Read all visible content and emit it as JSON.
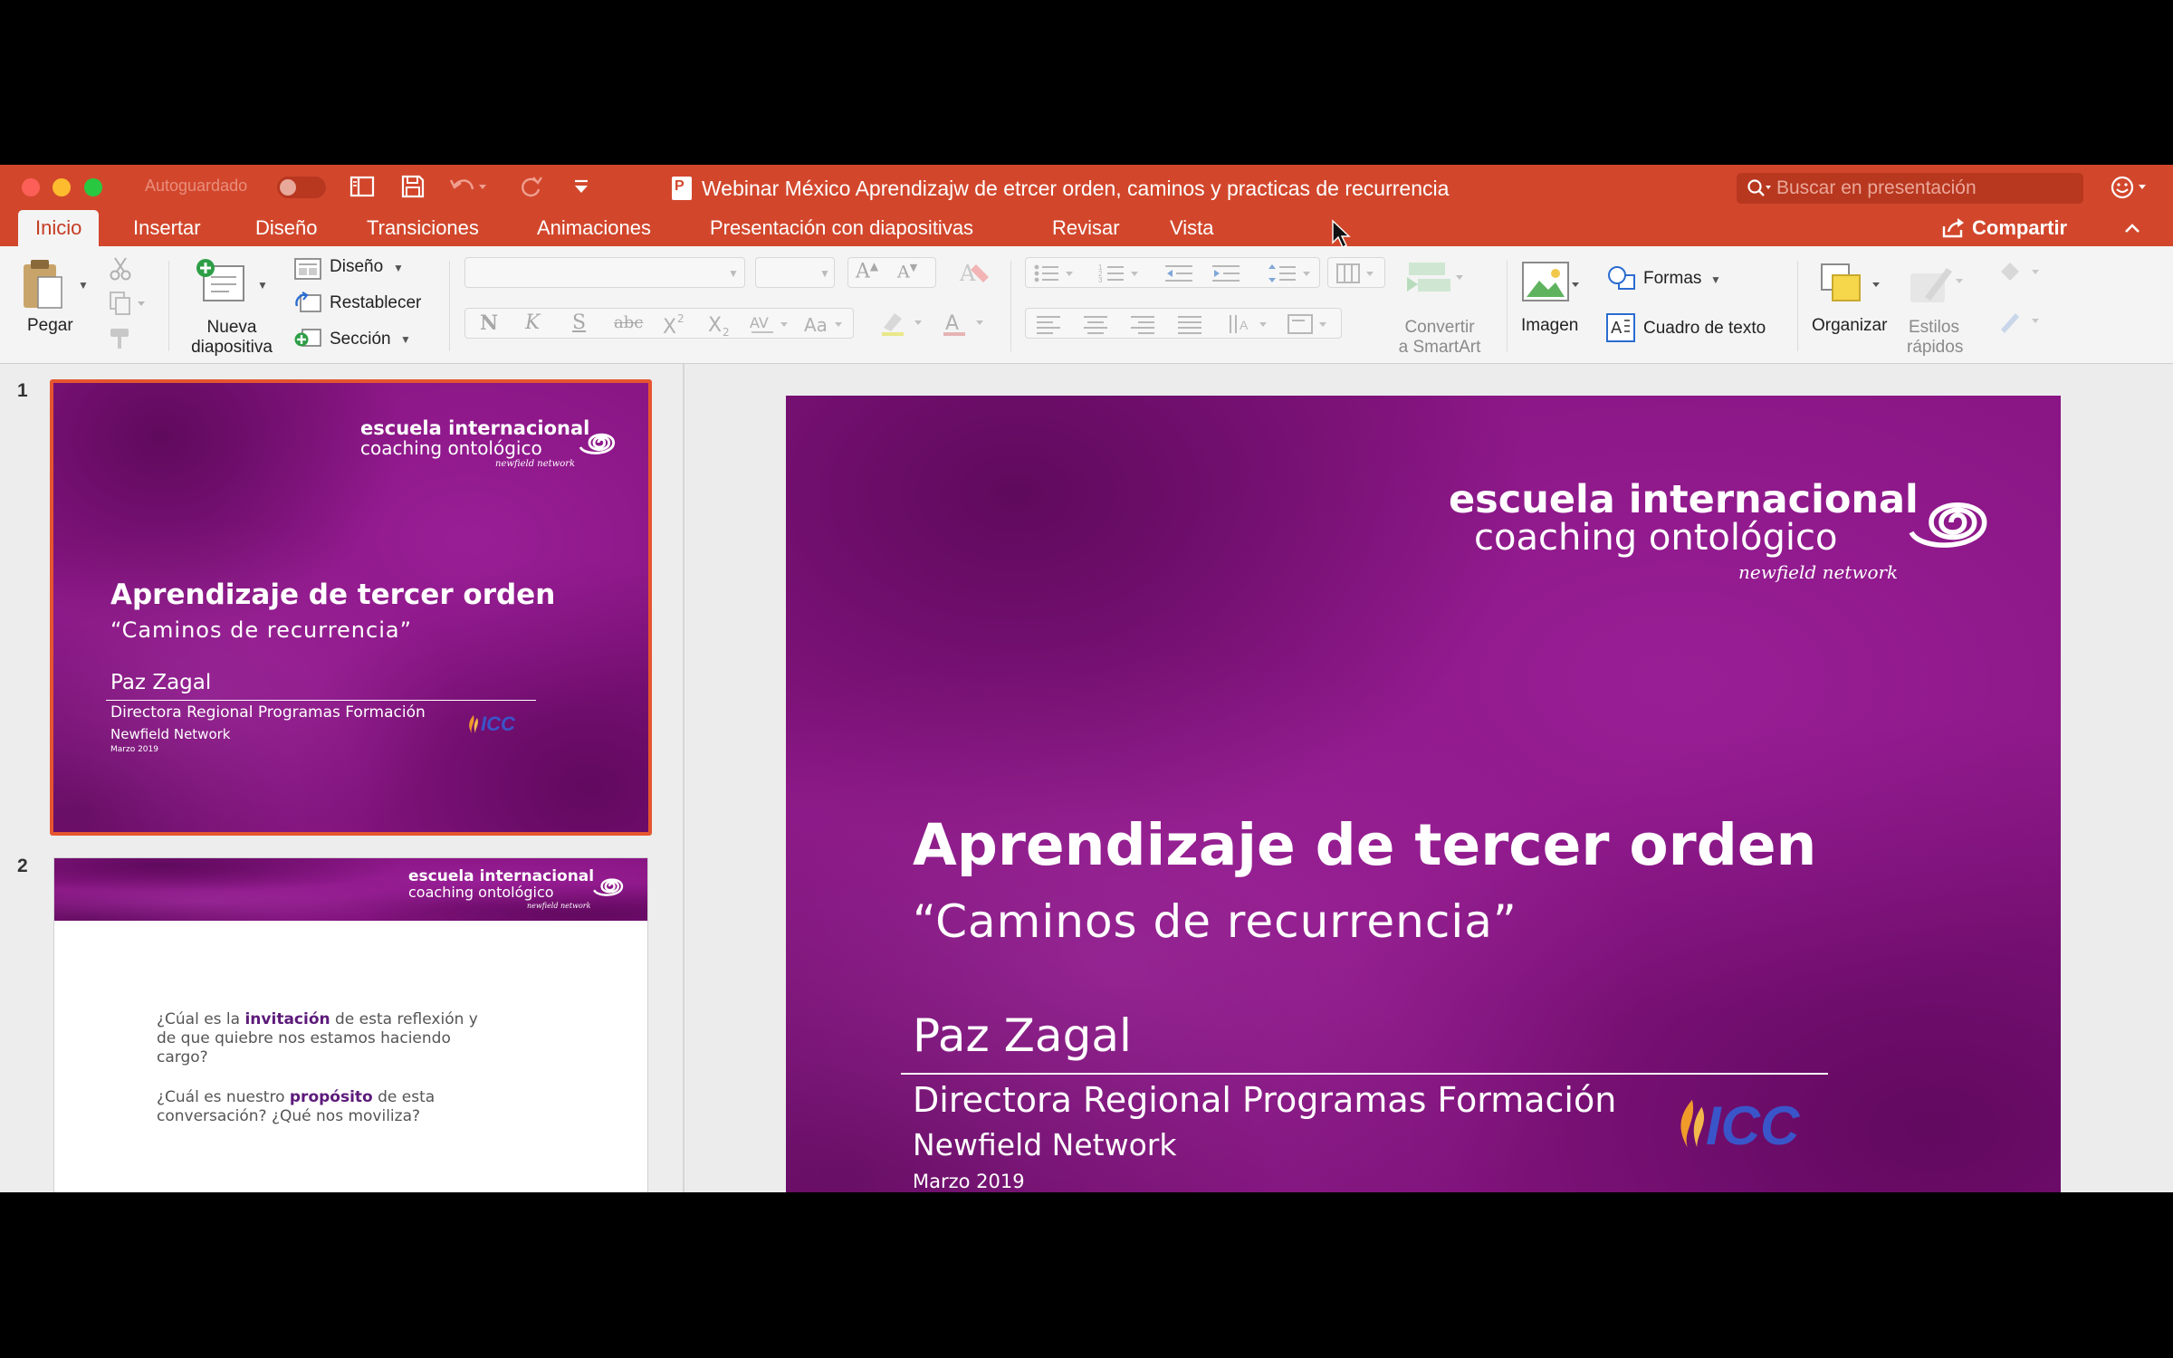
{
  "window": {
    "title": "Webinar México Aprendizajw de etrcer orden, caminos y practicas de recurrencia",
    "autosave_label": "Autoguardado",
    "search_placeholder": "Buscar en presentación"
  },
  "tabs": [
    {
      "label": "Inicio",
      "active": true
    },
    {
      "label": "Insertar"
    },
    {
      "label": "Diseño"
    },
    {
      "label": "Transiciones"
    },
    {
      "label": "Animaciones"
    },
    {
      "label": "Presentación con diapositivas"
    },
    {
      "label": "Revisar"
    },
    {
      "label": "Vista"
    }
  ],
  "share_label": "Compartir",
  "ribbon": {
    "paste_label": "Pegar",
    "new_slide_label_1": "Nueva",
    "new_slide_label_2": "diapositiva",
    "layout_label": "Diseño",
    "reset_label": "Restablecer",
    "section_label": "Sección",
    "font_glyphs": [
      "N",
      "K",
      "S",
      "abc"
    ],
    "smartart_label_1": "Convertir",
    "smartart_label_2": "a SmartArt",
    "image_label": "Imagen",
    "shapes_label": "Formas",
    "textbox_label": "Cuadro de texto",
    "arrange_label": "Organizar",
    "quickstyles_label_1": "Estilos",
    "quickstyles_label_2": "rápidos"
  },
  "colors": {
    "accent": "#d2472c",
    "slide_purple": "#8a1685",
    "selection": "#e5552f"
  },
  "slides": [
    {
      "number": "1",
      "logo_line1": "escuela internacional",
      "logo_line2": "coaching ontológico",
      "logo_line3": "newfield network",
      "title": "Aprendizaje de tercer orden",
      "subtitle": "“Caminos de recurrencia”",
      "presenter": "Paz Zagal",
      "role": "Directora Regional Programas Formación",
      "org": "Newfield Network",
      "date": "Marzo 2019",
      "badge": "ICC"
    },
    {
      "number": "2",
      "logo_line1": "escuela internacional",
      "logo_line2": "coaching ontológico",
      "logo_line3": "newfield network",
      "q1_before": "¿Cúal es la ",
      "q1_highlight": "invitación",
      "q1_after": " de esta reflexión y",
      "q1_line2": "de que quiebre nos estamos haciendo",
      "q1_line3": "cargo?",
      "q2_before": "¿Cuál es nuestro ",
      "q2_highlight": "propósito",
      "q2_after": " de esta",
      "q2_line2": "conversación? ¿Qué nos moviliza?"
    }
  ]
}
